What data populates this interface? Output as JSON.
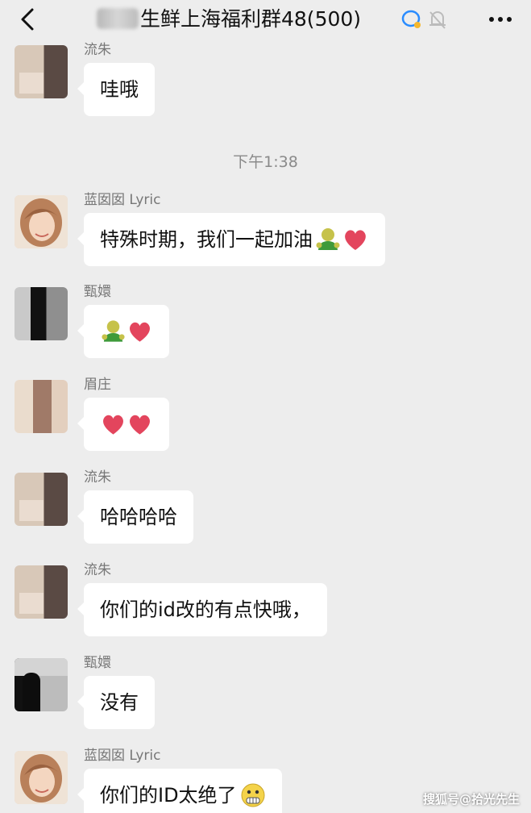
{
  "header": {
    "title_visible": "生鲜上海福利群48(500)",
    "icons": [
      "back-icon",
      "group-chat-icon",
      "mute-bell-icon",
      "more-icon"
    ]
  },
  "timestamp": "下午1:38",
  "messages": [
    {
      "sender": "流朱",
      "text": "哇哦",
      "emoji": [],
      "avatar": "blurred-photo"
    },
    {
      "sender": "蓝囡囡 Lyric",
      "text": "特殊时期，我们一起加油",
      "emoji": [
        "strong-icon",
        "heart-icon"
      ],
      "avatar": "girl-photo"
    },
    {
      "sender": "甄嬛",
      "text": "",
      "emoji": [
        "strong-icon",
        "heart-icon"
      ],
      "avatar": "blurred-photo"
    },
    {
      "sender": "眉庄",
      "text": "",
      "emoji": [
        "heart-icon",
        "heart-icon"
      ],
      "avatar": "blurred-photo"
    },
    {
      "sender": "流朱",
      "text": "哈哈哈哈",
      "emoji": [],
      "avatar": "blurred-photo"
    },
    {
      "sender": "流朱",
      "text": "你们的id改的有点快哦，",
      "emoji": [],
      "avatar": "blurred-photo"
    },
    {
      "sender": "甄嬛",
      "text": "没有",
      "emoji": [],
      "avatar": "blurred-photo"
    },
    {
      "sender": "蓝囡囡 Lyric",
      "text": "你们的ID太绝了",
      "emoji": [
        "grimace-icon"
      ],
      "avatar": "girl-photo"
    }
  ],
  "watermark": "搜狐号@拾光先生"
}
